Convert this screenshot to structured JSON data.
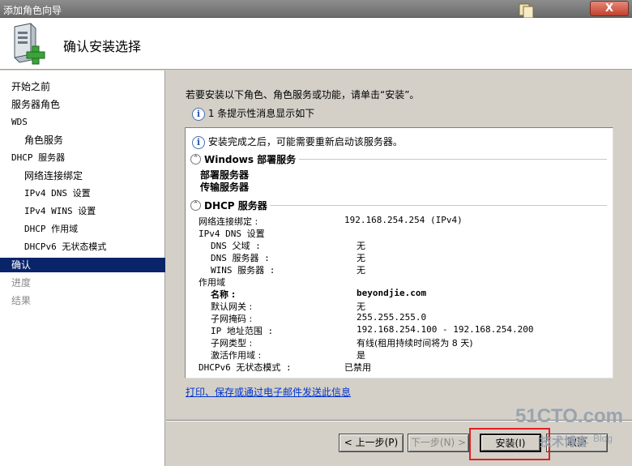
{
  "window": {
    "title": "添加角色向导",
    "close_label": "X"
  },
  "header": {
    "title": "确认安装选择"
  },
  "sidebar": {
    "items": [
      {
        "label": "开始之前",
        "state": "normal",
        "sub": false,
        "mono": false
      },
      {
        "label": "服务器角色",
        "state": "normal",
        "sub": false,
        "mono": false
      },
      {
        "label": "WDS",
        "state": "normal",
        "sub": false,
        "mono": true
      },
      {
        "label": "角色服务",
        "state": "normal",
        "sub": true,
        "mono": false
      },
      {
        "label": "DHCP 服务器",
        "state": "normal",
        "sub": false,
        "mono": true
      },
      {
        "label": "网络连接绑定",
        "state": "normal",
        "sub": true,
        "mono": false
      },
      {
        "label": "IPv4 DNS 设置",
        "state": "normal",
        "sub": true,
        "mono": true
      },
      {
        "label": "IPv4 WINS 设置",
        "state": "normal",
        "sub": true,
        "mono": true
      },
      {
        "label": "DHCP 作用域",
        "state": "normal",
        "sub": true,
        "mono": true
      },
      {
        "label": "DHCPv6 无状态模式",
        "state": "normal",
        "sub": true,
        "mono": true
      },
      {
        "label": "确认",
        "state": "active",
        "sub": false,
        "mono": false
      },
      {
        "label": "进度",
        "state": "disabled",
        "sub": false,
        "mono": false
      },
      {
        "label": "结果",
        "state": "disabled",
        "sub": false,
        "mono": false
      }
    ]
  },
  "main": {
    "intro": "若要安装以下角色、角色服务或功能，请单击“安装”。",
    "info_message": "1 条提示性消息显示如下",
    "panel": {
      "restart_note": "安装完成之后，可能需要重新启动该服务器。",
      "sections": [
        {
          "title": "Windows 部署服务",
          "items": [
            "部署服务器",
            "传输服务器"
          ]
        },
        {
          "title": "DHCP 服务器",
          "rows": [
            {
              "label": "网络连接绑定 :",
              "value": "192.168.254.254 (IPv4)"
            },
            {
              "label": "IPv4 DNS 设置",
              "value": ""
            },
            {
              "label": "DNS 父域 :",
              "value": "无"
            },
            {
              "label": "DNS 服务器 :",
              "value": "无"
            },
            {
              "label": "WINS 服务器 :",
              "value": "无"
            },
            {
              "label": "作用域",
              "value": ""
            },
            {
              "label": "名称 :",
              "value": "beyondjie.com"
            },
            {
              "label": "默认网关 :",
              "value": "无"
            },
            {
              "label": "子网掩码 :",
              "value": "255.255.255.0"
            },
            {
              "label": "IP 地址范围 :",
              "value": "192.168.254.100 - 192.168.254.200"
            },
            {
              "label": "子网类型 :",
              "value": "有线(租用持续时间将为 8 天)"
            },
            {
              "label": "激活作用域 :",
              "value": "是"
            },
            {
              "label": "DHCPv6 无状态模式 :",
              "value": "已禁用"
            }
          ]
        }
      ]
    },
    "email_link": "打印、保存或通过电子邮件发送此信息"
  },
  "buttons": {
    "prev": "< 上一步(P)",
    "next": "下一步(N) >",
    "install": "安装(I)",
    "cancel": "取消"
  },
  "watermark": {
    "main": "51CTO.com",
    "sub": "技术博客",
    "blog": "Blog"
  },
  "colors": {
    "selection": "#0a246a",
    "highlight_box": "#e02020",
    "link": "#0033cc"
  }
}
